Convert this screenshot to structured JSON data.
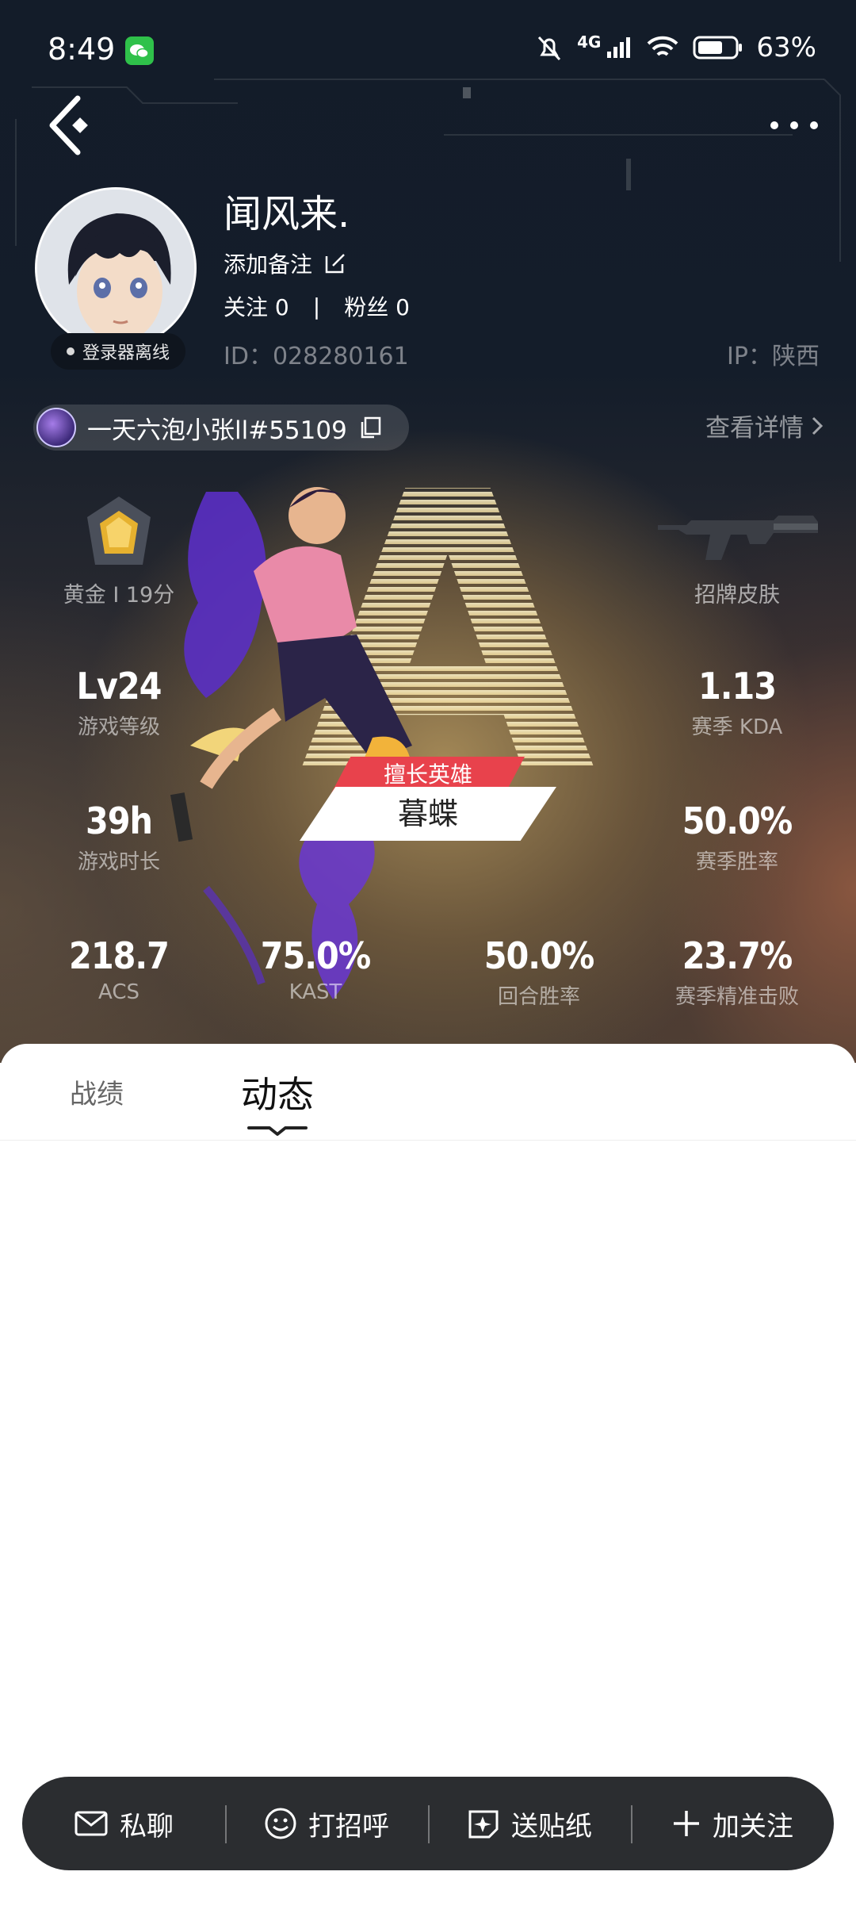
{
  "status_bar": {
    "time": "8:49",
    "network": "4G",
    "battery": "63%"
  },
  "profile": {
    "name": "闻风来.",
    "remark": "添加备注",
    "follow_label": "关注",
    "follow_count": "0",
    "fans_label": "粉丝",
    "fans_count": "0",
    "id_text": "ID：028280161",
    "ip_text": "IP：陕西",
    "online_status": "登录器离线"
  },
  "game": {
    "account": "一天六泡小张ll#55109",
    "view_details": "查看详情",
    "rank_grade": "A",
    "rank": "黄金 I 19分",
    "signature_skin": "招牌皮肤",
    "favorite_label": "擅长英雄",
    "favorite_hero": "暮蝶",
    "stats": [
      {
        "value": "Lv24",
        "label": "游戏等级"
      },
      {
        "value": "1.13",
        "label": "赛季 KDA"
      },
      {
        "value": "39h",
        "label": "游戏时长"
      },
      {
        "value": "50.0%",
        "label": "赛季胜率"
      },
      {
        "value": "218.7",
        "label": "ACS"
      },
      {
        "value": "75.0%",
        "label": "KAST"
      },
      {
        "value": "50.0%",
        "label": "回合胜率"
      },
      {
        "value": "23.7%",
        "label": "赛季精准击败"
      }
    ]
  },
  "tabs": [
    {
      "label": "战绩",
      "active": false
    },
    {
      "label": "动态",
      "active": true
    }
  ],
  "actions": {
    "message": "私聊",
    "greet": "打招呼",
    "sticker": "送贴纸",
    "follow": "加关注"
  },
  "colors": {
    "accent_red": "#e8424c",
    "hero_dark": "#131c29",
    "bar_bg": "#2b2d30"
  }
}
